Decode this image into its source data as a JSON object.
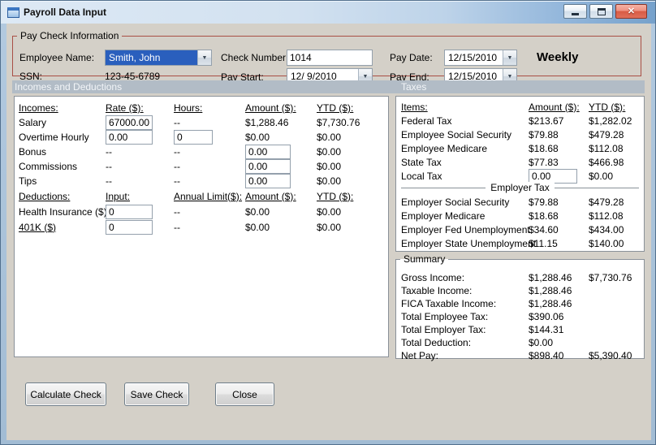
{
  "window": {
    "title": "Payroll Data Input"
  },
  "icons": {
    "close": "✕",
    "dropdown": "▼"
  },
  "colors": {
    "titlebar_blue": "#76a1cb",
    "selection_blue": "#2a5fbd",
    "group_border_red": "#a94f45",
    "section_header_bg": "#b2bcc6",
    "client_bg": "#d4d0c8"
  },
  "paycheck": {
    "group_title": "Pay Check Information",
    "employee_name_label": "Employee Name:",
    "employee_name_value": "Smith, John",
    "ssn_label": "SSN:",
    "ssn_value": "123-45-6789",
    "check_number_label": "Check Number:",
    "check_number_value": "1014",
    "pay_start_label": "Pay Start:",
    "pay_start_value": "12/ 9/2010",
    "pay_date_label": "Pay Date:",
    "pay_date_value": "12/15/2010",
    "pay_end_label": "Pay End:",
    "pay_end_value": "12/15/2010",
    "frequency": "Weekly"
  },
  "section_headers": {
    "incomes": "Incomes and Deductions",
    "taxes": "Taxes"
  },
  "incomes": {
    "headers": {
      "item": "Incomes:",
      "rate": "Rate ($):",
      "hours": "Hours:",
      "amount": "Amount ($):",
      "ytd": "YTD ($):"
    },
    "rows": [
      {
        "label": "Salary",
        "rate": "67000.00",
        "hours": "--",
        "amount": "$1,288.46",
        "ytd": "$7,730.76"
      },
      {
        "label": "Overtime Hourly",
        "rate": "0.00",
        "hours": "0",
        "amount": "$0.00",
        "ytd": "$0.00"
      },
      {
        "label": "Bonus",
        "rate": "--",
        "hours": "--",
        "amount": "0.00",
        "ytd": "$0.00"
      },
      {
        "label": "Commissions",
        "rate": "--",
        "hours": "--",
        "amount": "0.00",
        "ytd": "$0.00"
      },
      {
        "label": "Tips",
        "rate": "--",
        "hours": "--",
        "amount": "0.00",
        "ytd": "$0.00"
      }
    ]
  },
  "deductions": {
    "headers": {
      "item": "Deductions:",
      "input": "Input:",
      "limit": "Annual Limit($):",
      "amount": "Amount ($):",
      "ytd": "YTD ($):"
    },
    "rows": [
      {
        "label": "Health Insurance  ($)",
        "input": "0",
        "limit": "--",
        "amount": "$0.00",
        "ytd": "$0.00"
      },
      {
        "label": "401K  ($)",
        "input": "0",
        "limit": "--",
        "amount": "$0.00",
        "ytd": "$0.00"
      }
    ]
  },
  "taxes": {
    "headers": {
      "item": "Items:",
      "amount": "Amount ($):",
      "ytd": "YTD ($):"
    },
    "employee_rows": [
      {
        "label": "Federal Tax",
        "amount": "$213.67",
        "ytd": "$1,282.02"
      },
      {
        "label": "Employee Social Security",
        "amount": "$79.88",
        "ytd": "$479.28"
      },
      {
        "label": "Employee Medicare",
        "amount": "$18.68",
        "ytd": "$112.08"
      },
      {
        "label": "State Tax",
        "amount": "$77.83",
        "ytd": "$466.98"
      }
    ],
    "local_tax": {
      "label": "Local Tax",
      "amount": "0.00",
      "ytd": "$0.00"
    },
    "employer_header": "Employer Tax",
    "employer_rows": [
      {
        "label": "Employer Social Security",
        "amount": "$79.88",
        "ytd": "$479.28"
      },
      {
        "label": "Employer Medicare",
        "amount": "$18.68",
        "ytd": "$112.08"
      },
      {
        "label": "Employer Fed Unemployment",
        "amount": "$34.60",
        "ytd": "$434.00"
      },
      {
        "label": "Employer State Unemployment",
        "amount": "$11.15",
        "ytd": "$140.00"
      }
    ]
  },
  "summary": {
    "group_title": "Summary",
    "rows": [
      {
        "label": "Gross Income:",
        "amount": "$1,288.46",
        "ytd": "$7,730.76"
      },
      {
        "label": "Taxable Income:",
        "amount": "$1,288.46",
        "ytd": ""
      },
      {
        "label": "FICA Taxable Income:",
        "amount": "$1,288.46",
        "ytd": ""
      },
      {
        "label": "Total Employee Tax:",
        "amount": "$390.06",
        "ytd": ""
      },
      {
        "label": "Total Employer Tax:",
        "amount": "$144.31",
        "ytd": ""
      },
      {
        "label": "Total Deduction:",
        "amount": "$0.00",
        "ytd": ""
      },
      {
        "label": "Net Pay:",
        "amount": "$898.40",
        "ytd": "$5,390.40"
      }
    ]
  },
  "buttons": {
    "calculate": "Calculate Check",
    "save": "Save Check",
    "close": "Close"
  }
}
